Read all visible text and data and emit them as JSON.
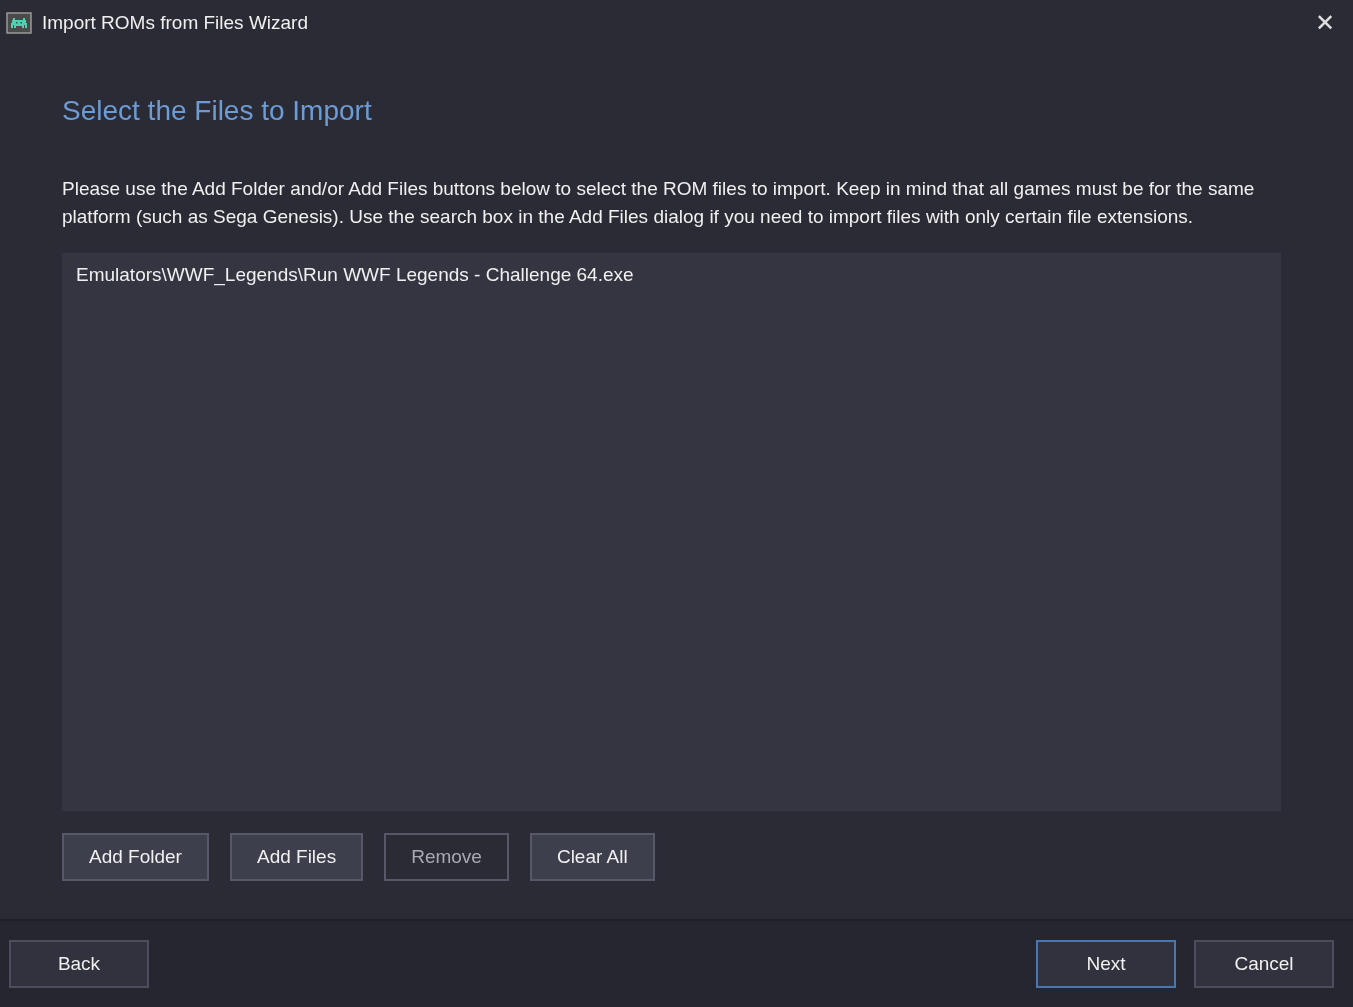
{
  "window": {
    "title": "Import ROMs from Files Wizard",
    "close": "✕"
  },
  "heading": "Select the Files to Import",
  "description": "Please use the Add Folder and/or Add Files buttons below to select the ROM files to import. Keep in mind that all games must be for the same platform (such as Sega Genesis). Use the search box in the Add Files dialog if you need to import files with only certain file extensions.",
  "files": [
    {
      "path": "Emulators\\WWF_Legends\\Run WWF Legends - Challenge 64.exe",
      "selected": false
    }
  ],
  "list_buttons": [
    {
      "label": "Add Folder",
      "disabled": false
    },
    {
      "label": "Add Files",
      "disabled": false
    },
    {
      "label": "Remove",
      "disabled": true
    },
    {
      "label": "Clear All",
      "disabled": false
    }
  ],
  "footer": {
    "left": [
      {
        "label": "Back",
        "default": false
      }
    ],
    "right": [
      {
        "label": "Next",
        "default": true
      },
      {
        "label": "Cancel",
        "default": false
      }
    ]
  }
}
